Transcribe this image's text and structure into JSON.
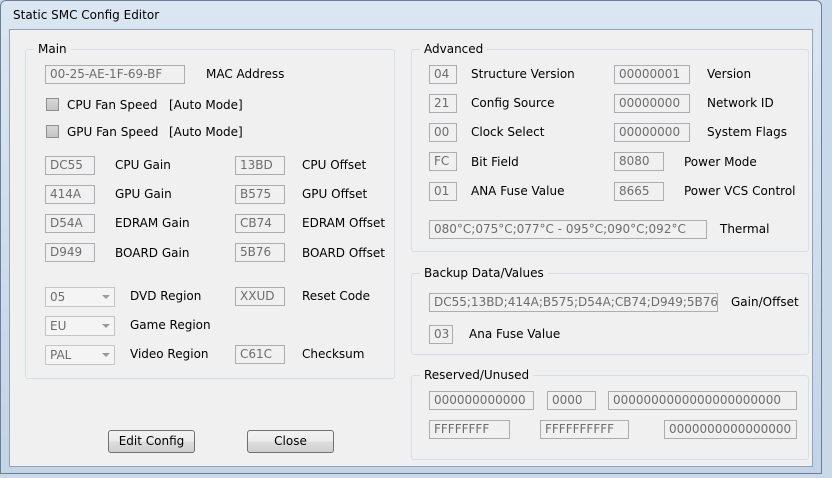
{
  "window": {
    "title": "Static SMC Config Editor"
  },
  "main": {
    "title": "Main",
    "mac": {
      "value": "00-25-AE-1F-69-BF",
      "label": "MAC Address"
    },
    "cpu_fan": {
      "label": "CPU Fan Speed",
      "mode": "[Auto Mode]"
    },
    "gpu_fan": {
      "label": "GPU Fan Speed",
      "mode": "[Auto Mode]"
    },
    "cpu_gain": {
      "value": "DC55",
      "label": "CPU Gain"
    },
    "gpu_gain": {
      "value": "414A",
      "label": "GPU Gain"
    },
    "edram_gain": {
      "value": "D54A",
      "label": "EDRAM Gain"
    },
    "board_gain": {
      "value": "D949",
      "label": "BOARD Gain"
    },
    "cpu_offset": {
      "value": "13BD",
      "label": "CPU Offset"
    },
    "gpu_offset": {
      "value": "B575",
      "label": "GPU Offset"
    },
    "edram_offset": {
      "value": "CB74",
      "label": "EDRAM Offset"
    },
    "board_offset": {
      "value": "5B76",
      "label": "BOARD Offset"
    },
    "dvd_region": {
      "value": "05",
      "label": "DVD Region"
    },
    "game_region": {
      "value": "EU",
      "label": "Game Region"
    },
    "video_region": {
      "value": "PAL",
      "label": "Video Region"
    },
    "reset_code": {
      "value": "XXUD",
      "label": "Reset Code"
    },
    "checksum": {
      "value": "C61C",
      "label": "Checksum"
    }
  },
  "advanced": {
    "title": "Advanced",
    "structure_version": {
      "value": "04",
      "label": "Structure Version"
    },
    "config_source": {
      "value": "21",
      "label": "Config Source"
    },
    "clock_select": {
      "value": "00",
      "label": "Clock Select"
    },
    "bit_field": {
      "value": "FC",
      "label": "Bit Field"
    },
    "ana_fuse_value": {
      "value": "01",
      "label": "ANA Fuse Value"
    },
    "version": {
      "value": "00000001",
      "label": "Version"
    },
    "network_id": {
      "value": "00000000",
      "label": "Network ID"
    },
    "system_flags": {
      "value": "00000000",
      "label": "System Flags"
    },
    "power_mode": {
      "value": "8080",
      "label": "Power Mode"
    },
    "power_vcs": {
      "value": "8665",
      "label": "Power VCS Control"
    },
    "thermal": {
      "value": "080°C;075°C;077°C  -  095°C;090°C;092°C",
      "label": "Thermal"
    }
  },
  "backup": {
    "title": "Backup Data/Values",
    "gain_offset": {
      "value": "DC55;13BD;414A;B575;D54A;CB74;D949;5B76",
      "label": "Gain/Offset"
    },
    "ana_fuse": {
      "value": "03",
      "label": "Ana Fuse Value"
    }
  },
  "reserved": {
    "title": "Reserved/Unused",
    "r1": "000000000000",
    "r2": "0000",
    "r3": "0000000000000000000000",
    "r4": "FFFFFFFF",
    "r5": "FFFFFFFFFF",
    "r6": "0000000000000000"
  },
  "buttons": {
    "edit": "Edit Config",
    "close": "Close"
  }
}
